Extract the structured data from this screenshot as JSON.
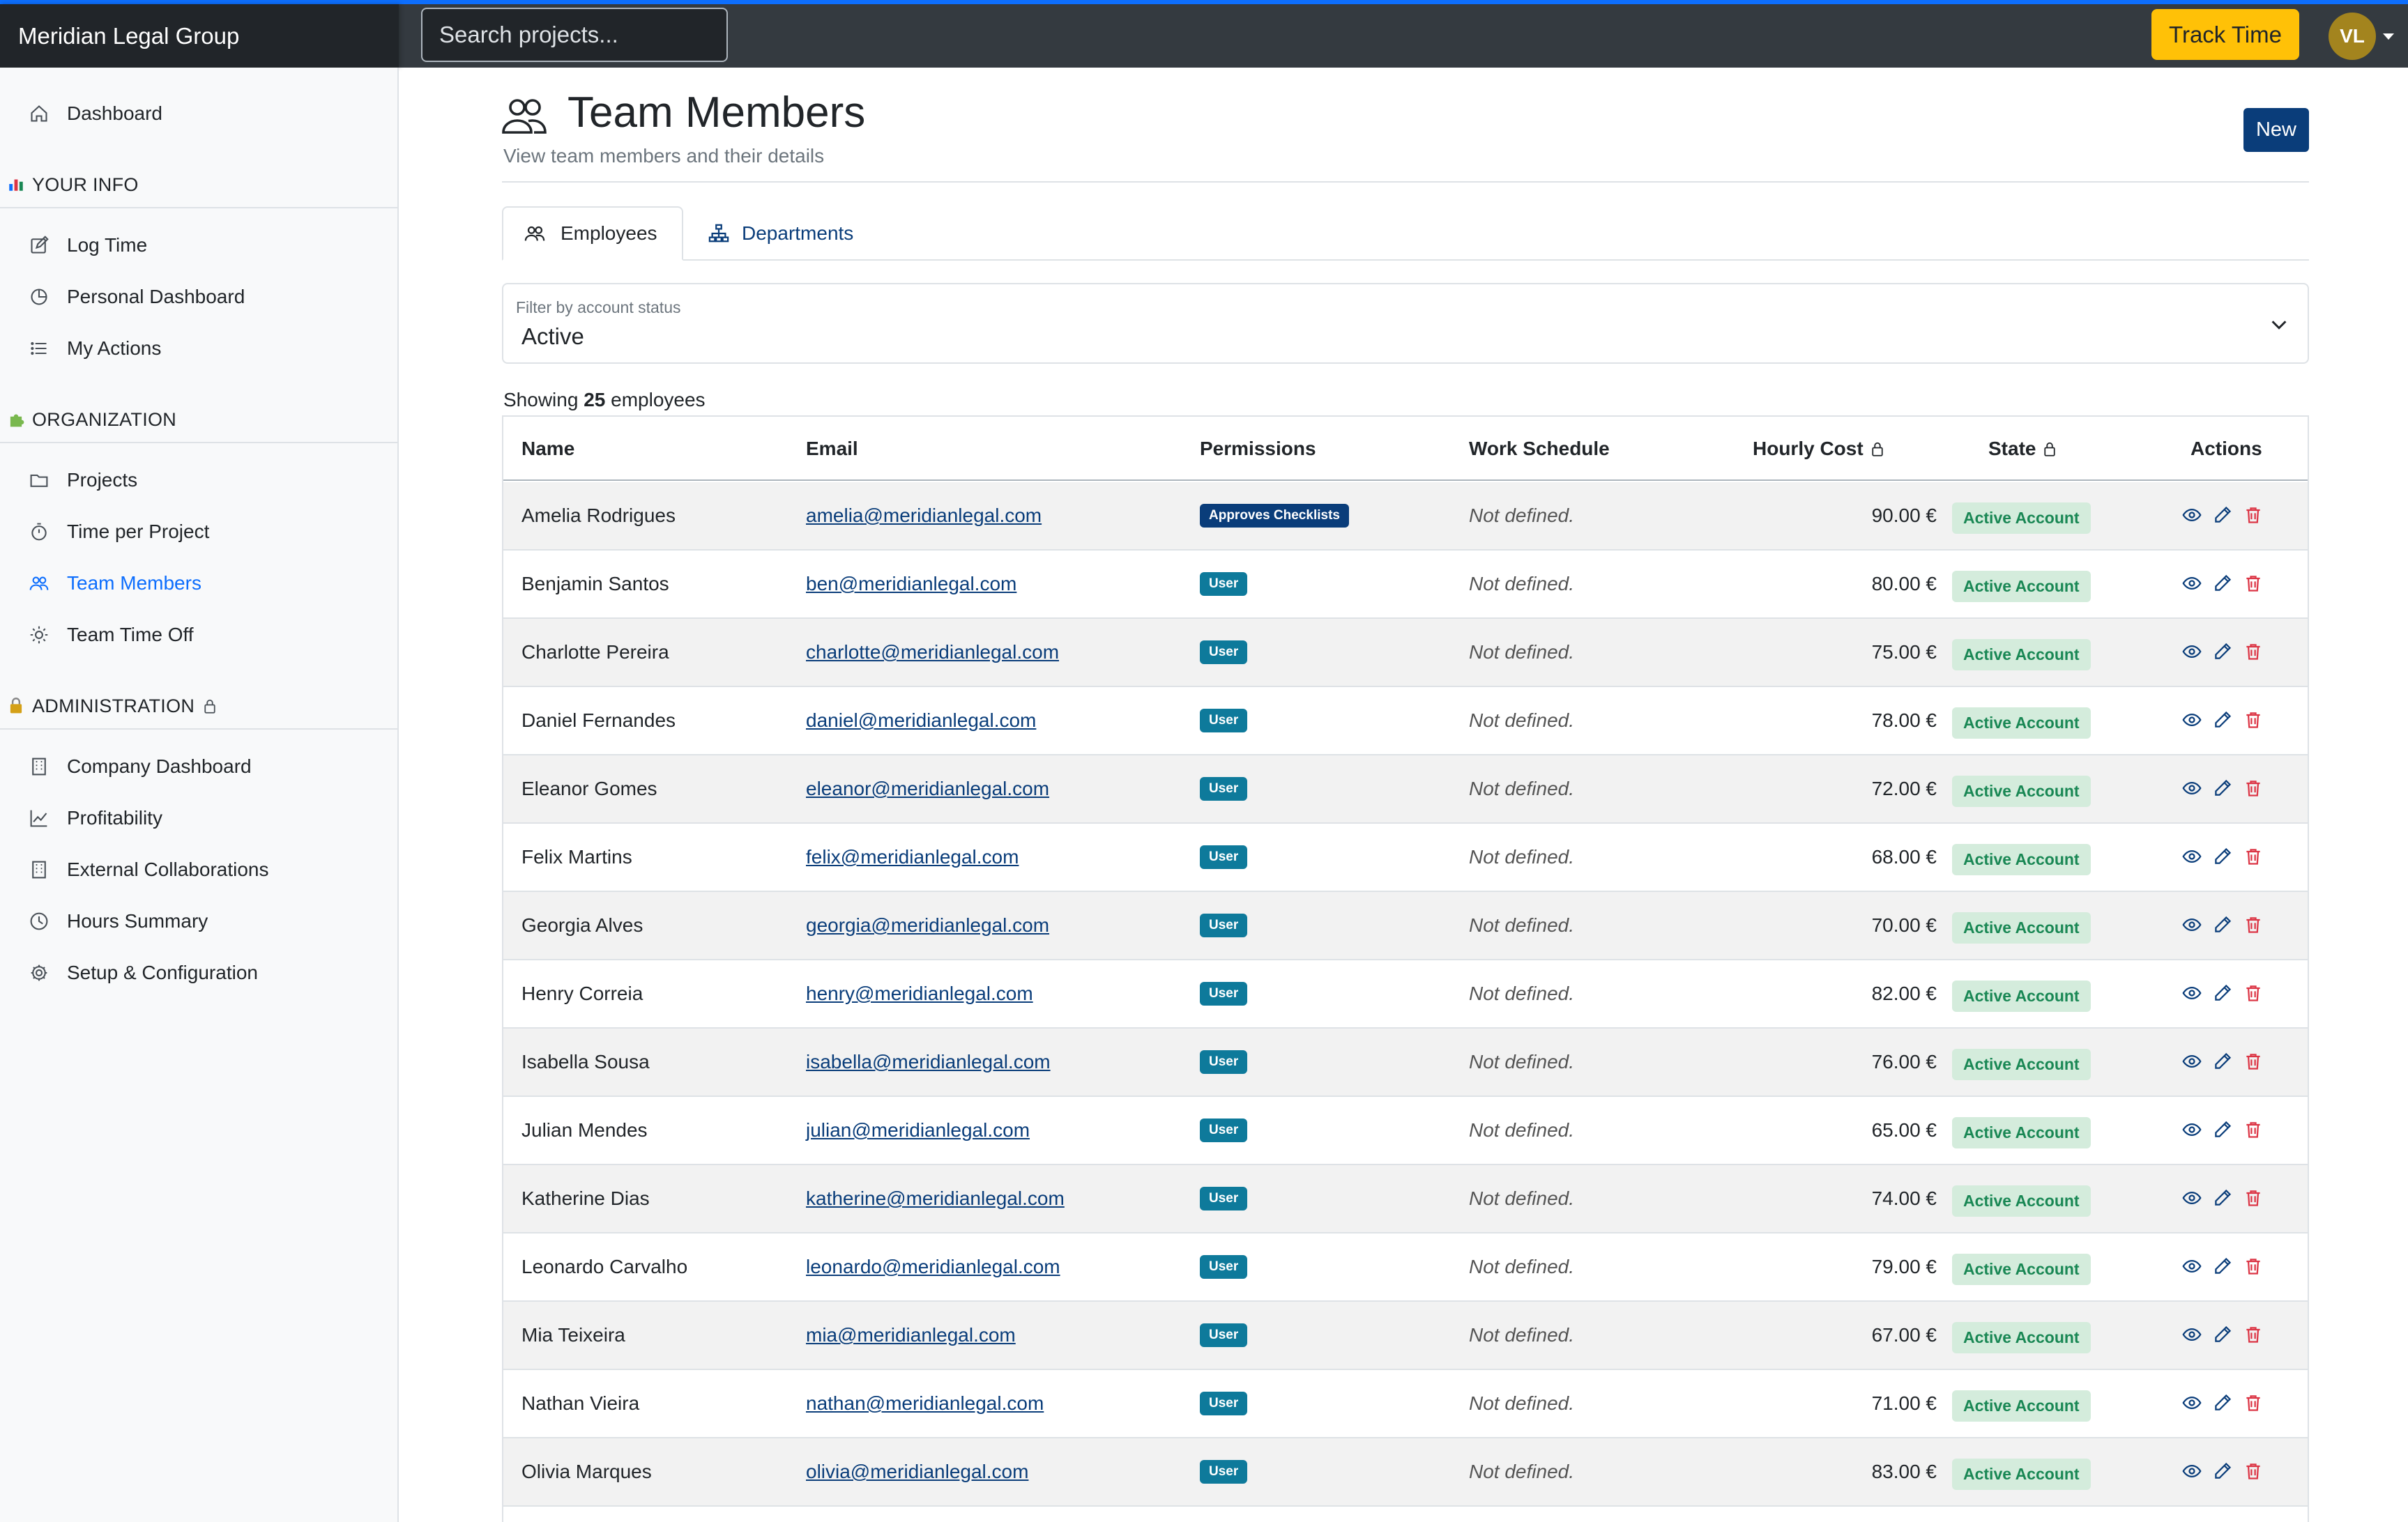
{
  "app": {
    "brand": "Meridian Legal Group",
    "search_placeholder": "Search projects...",
    "track_label": "Track Time",
    "avatar_initials": "VL",
    "accent_color": "#0d6efd",
    "track_color": "#ffc107"
  },
  "sidebar": {
    "dashboard": "Dashboard",
    "sections": [
      {
        "title": "YOUR INFO",
        "icon": "bar-chart-icon",
        "items": [
          {
            "label": "Log Time",
            "icon": "pencil-square-icon"
          },
          {
            "label": "Personal Dashboard",
            "icon": "pie-chart-icon"
          },
          {
            "label": "My Actions",
            "icon": "list-icon"
          }
        ]
      },
      {
        "title": "ORGANIZATION",
        "icon": "puzzle-icon",
        "items": [
          {
            "label": "Projects",
            "icon": "folder-icon"
          },
          {
            "label": "Time per Project",
            "icon": "stopwatch-icon"
          },
          {
            "label": "Team Members",
            "icon": "people-icon",
            "active": true
          },
          {
            "label": "Team Time Off",
            "icon": "sun-icon"
          }
        ]
      },
      {
        "title": "ADMINISTRATION",
        "icon": "lock-icon",
        "items": [
          {
            "label": "Company Dashboard",
            "icon": "building-icon"
          },
          {
            "label": "Profitability",
            "icon": "graph-up-icon"
          },
          {
            "label": "External Collaborations",
            "icon": "building-icon"
          },
          {
            "label": "Hours Summary",
            "icon": "clock-icon"
          },
          {
            "label": "Setup & Configuration",
            "icon": "gear-icon"
          }
        ]
      }
    ]
  },
  "page": {
    "title": "Team Members",
    "subtitle": "View team members and their details",
    "new_label": "New",
    "tabs": [
      {
        "label": "Employees",
        "active": true
      },
      {
        "label": "Departments",
        "active": false
      }
    ],
    "filter": {
      "label": "Filter by account status",
      "value": "Active"
    },
    "showing_prefix": "Showing",
    "showing_count": "25",
    "showing_suffix": "employees"
  },
  "table": {
    "columns": [
      "Name",
      "Email",
      "Permissions",
      "Work Schedule",
      "Hourly Cost",
      "State",
      "Actions"
    ],
    "rows": [
      {
        "name": "Amelia Rodrigues",
        "email": "amelia@meridianlegal.com",
        "permission": "Approves Checklists",
        "schedule": "Not defined.",
        "cost": "90.00 €",
        "state": "Active Account"
      },
      {
        "name": "Benjamin Santos",
        "email": "ben@meridianlegal.com",
        "permission": "User",
        "schedule": "Not defined.",
        "cost": "80.00 €",
        "state": "Active Account"
      },
      {
        "name": "Charlotte Pereira",
        "email": "charlotte@meridianlegal.com",
        "permission": "User",
        "schedule": "Not defined.",
        "cost": "75.00 €",
        "state": "Active Account"
      },
      {
        "name": "Daniel Fernandes",
        "email": "daniel@meridianlegal.com",
        "permission": "User",
        "schedule": "Not defined.",
        "cost": "78.00 €",
        "state": "Active Account"
      },
      {
        "name": "Eleanor Gomes",
        "email": "eleanor@meridianlegal.com",
        "permission": "User",
        "schedule": "Not defined.",
        "cost": "72.00 €",
        "state": "Active Account"
      },
      {
        "name": "Felix Martins",
        "email": "felix@meridianlegal.com",
        "permission": "User",
        "schedule": "Not defined.",
        "cost": "68.00 €",
        "state": "Active Account"
      },
      {
        "name": "Georgia Alves",
        "email": "georgia@meridianlegal.com",
        "permission": "User",
        "schedule": "Not defined.",
        "cost": "70.00 €",
        "state": "Active Account"
      },
      {
        "name": "Henry Correia",
        "email": "henry@meridianlegal.com",
        "permission": "User",
        "schedule": "Not defined.",
        "cost": "82.00 €",
        "state": "Active Account"
      },
      {
        "name": "Isabella Sousa",
        "email": "isabella@meridianlegal.com",
        "permission": "User",
        "schedule": "Not defined.",
        "cost": "76.00 €",
        "state": "Active Account"
      },
      {
        "name": "Julian Mendes",
        "email": "julian@meridianlegal.com",
        "permission": "User",
        "schedule": "Not defined.",
        "cost": "65.00 €",
        "state": "Active Account"
      },
      {
        "name": "Katherine Dias",
        "email": "katherine@meridianlegal.com",
        "permission": "User",
        "schedule": "Not defined.",
        "cost": "74.00 €",
        "state": "Active Account"
      },
      {
        "name": "Leonardo Carvalho",
        "email": "leonardo@meridianlegal.com",
        "permission": "User",
        "schedule": "Not defined.",
        "cost": "79.00 €",
        "state": "Active Account"
      },
      {
        "name": "Mia Teixeira",
        "email": "mia@meridianlegal.com",
        "permission": "User",
        "schedule": "Not defined.",
        "cost": "67.00 €",
        "state": "Active Account"
      },
      {
        "name": "Nathan Vieira",
        "email": "nathan@meridianlegal.com",
        "permission": "User",
        "schedule": "Not defined.",
        "cost": "71.00 €",
        "state": "Active Account"
      },
      {
        "name": "Olivia Marques",
        "email": "olivia@meridianlegal.com",
        "permission": "User",
        "schedule": "Not defined.",
        "cost": "83.00 €",
        "state": "Active Account"
      }
    ]
  }
}
